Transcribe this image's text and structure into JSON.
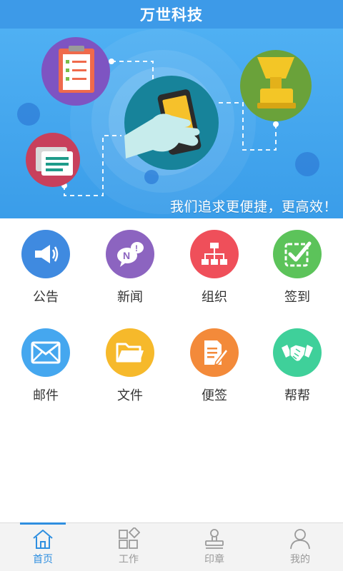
{
  "app": {
    "title": "万世科技"
  },
  "banner": {
    "slogan": "我们追求更便捷，更高效！"
  },
  "menu": [
    {
      "label": "公告",
      "icon": "megaphone-icon",
      "color": "#3f8ae0"
    },
    {
      "label": "新闻",
      "icon": "news-bubble-icon",
      "color": "#8c64c0"
    },
    {
      "label": "组织",
      "icon": "org-chart-icon",
      "color": "#ef4f5a"
    },
    {
      "label": "签到",
      "icon": "checkin-icon",
      "color": "#5cc35a"
    },
    {
      "label": "邮件",
      "icon": "mail-icon",
      "color": "#45a7ef"
    },
    {
      "label": "文件",
      "icon": "folder-icon",
      "color": "#f6b92b"
    },
    {
      "label": "便签",
      "icon": "note-pencil-icon",
      "color": "#f38a3a"
    },
    {
      "label": "帮帮",
      "icon": "handshake-icon",
      "color": "#3fd09a"
    }
  ],
  "tabs": [
    {
      "label": "首页",
      "icon": "home-icon",
      "active": true
    },
    {
      "label": "工作",
      "icon": "work-grid-icon",
      "active": false
    },
    {
      "label": "印章",
      "icon": "stamp-icon",
      "active": false
    },
    {
      "label": "我的",
      "icon": "user-icon",
      "active": false
    }
  ],
  "colors": {
    "accent": "#2f8fe0",
    "titlebar": "#3d9ae8"
  }
}
